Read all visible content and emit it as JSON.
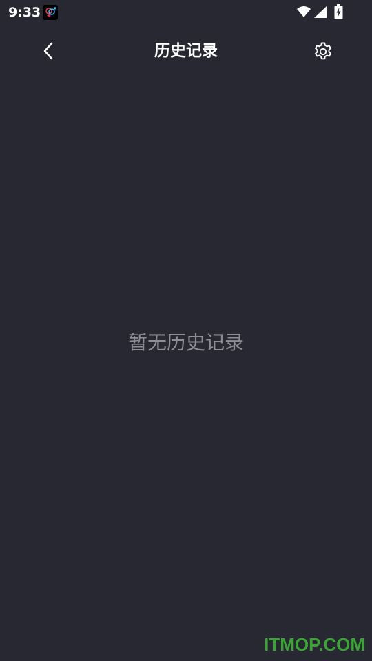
{
  "status_bar": {
    "time": "9:33",
    "icons": [
      "app-notification-icon",
      "wifi-icon",
      "signal-icon",
      "battery-charging-icon"
    ]
  },
  "header": {
    "title": "历史记录",
    "back_icon": "chevron-left-icon",
    "settings_icon": "gear-icon"
  },
  "main": {
    "empty_message": "暂无历史记录"
  },
  "watermark": {
    "text": "ITMOP.COM"
  },
  "colors": {
    "background": "#282833",
    "title_text": "#ffffff",
    "empty_text": "#8e8e94",
    "watermark": "#3aa535"
  }
}
